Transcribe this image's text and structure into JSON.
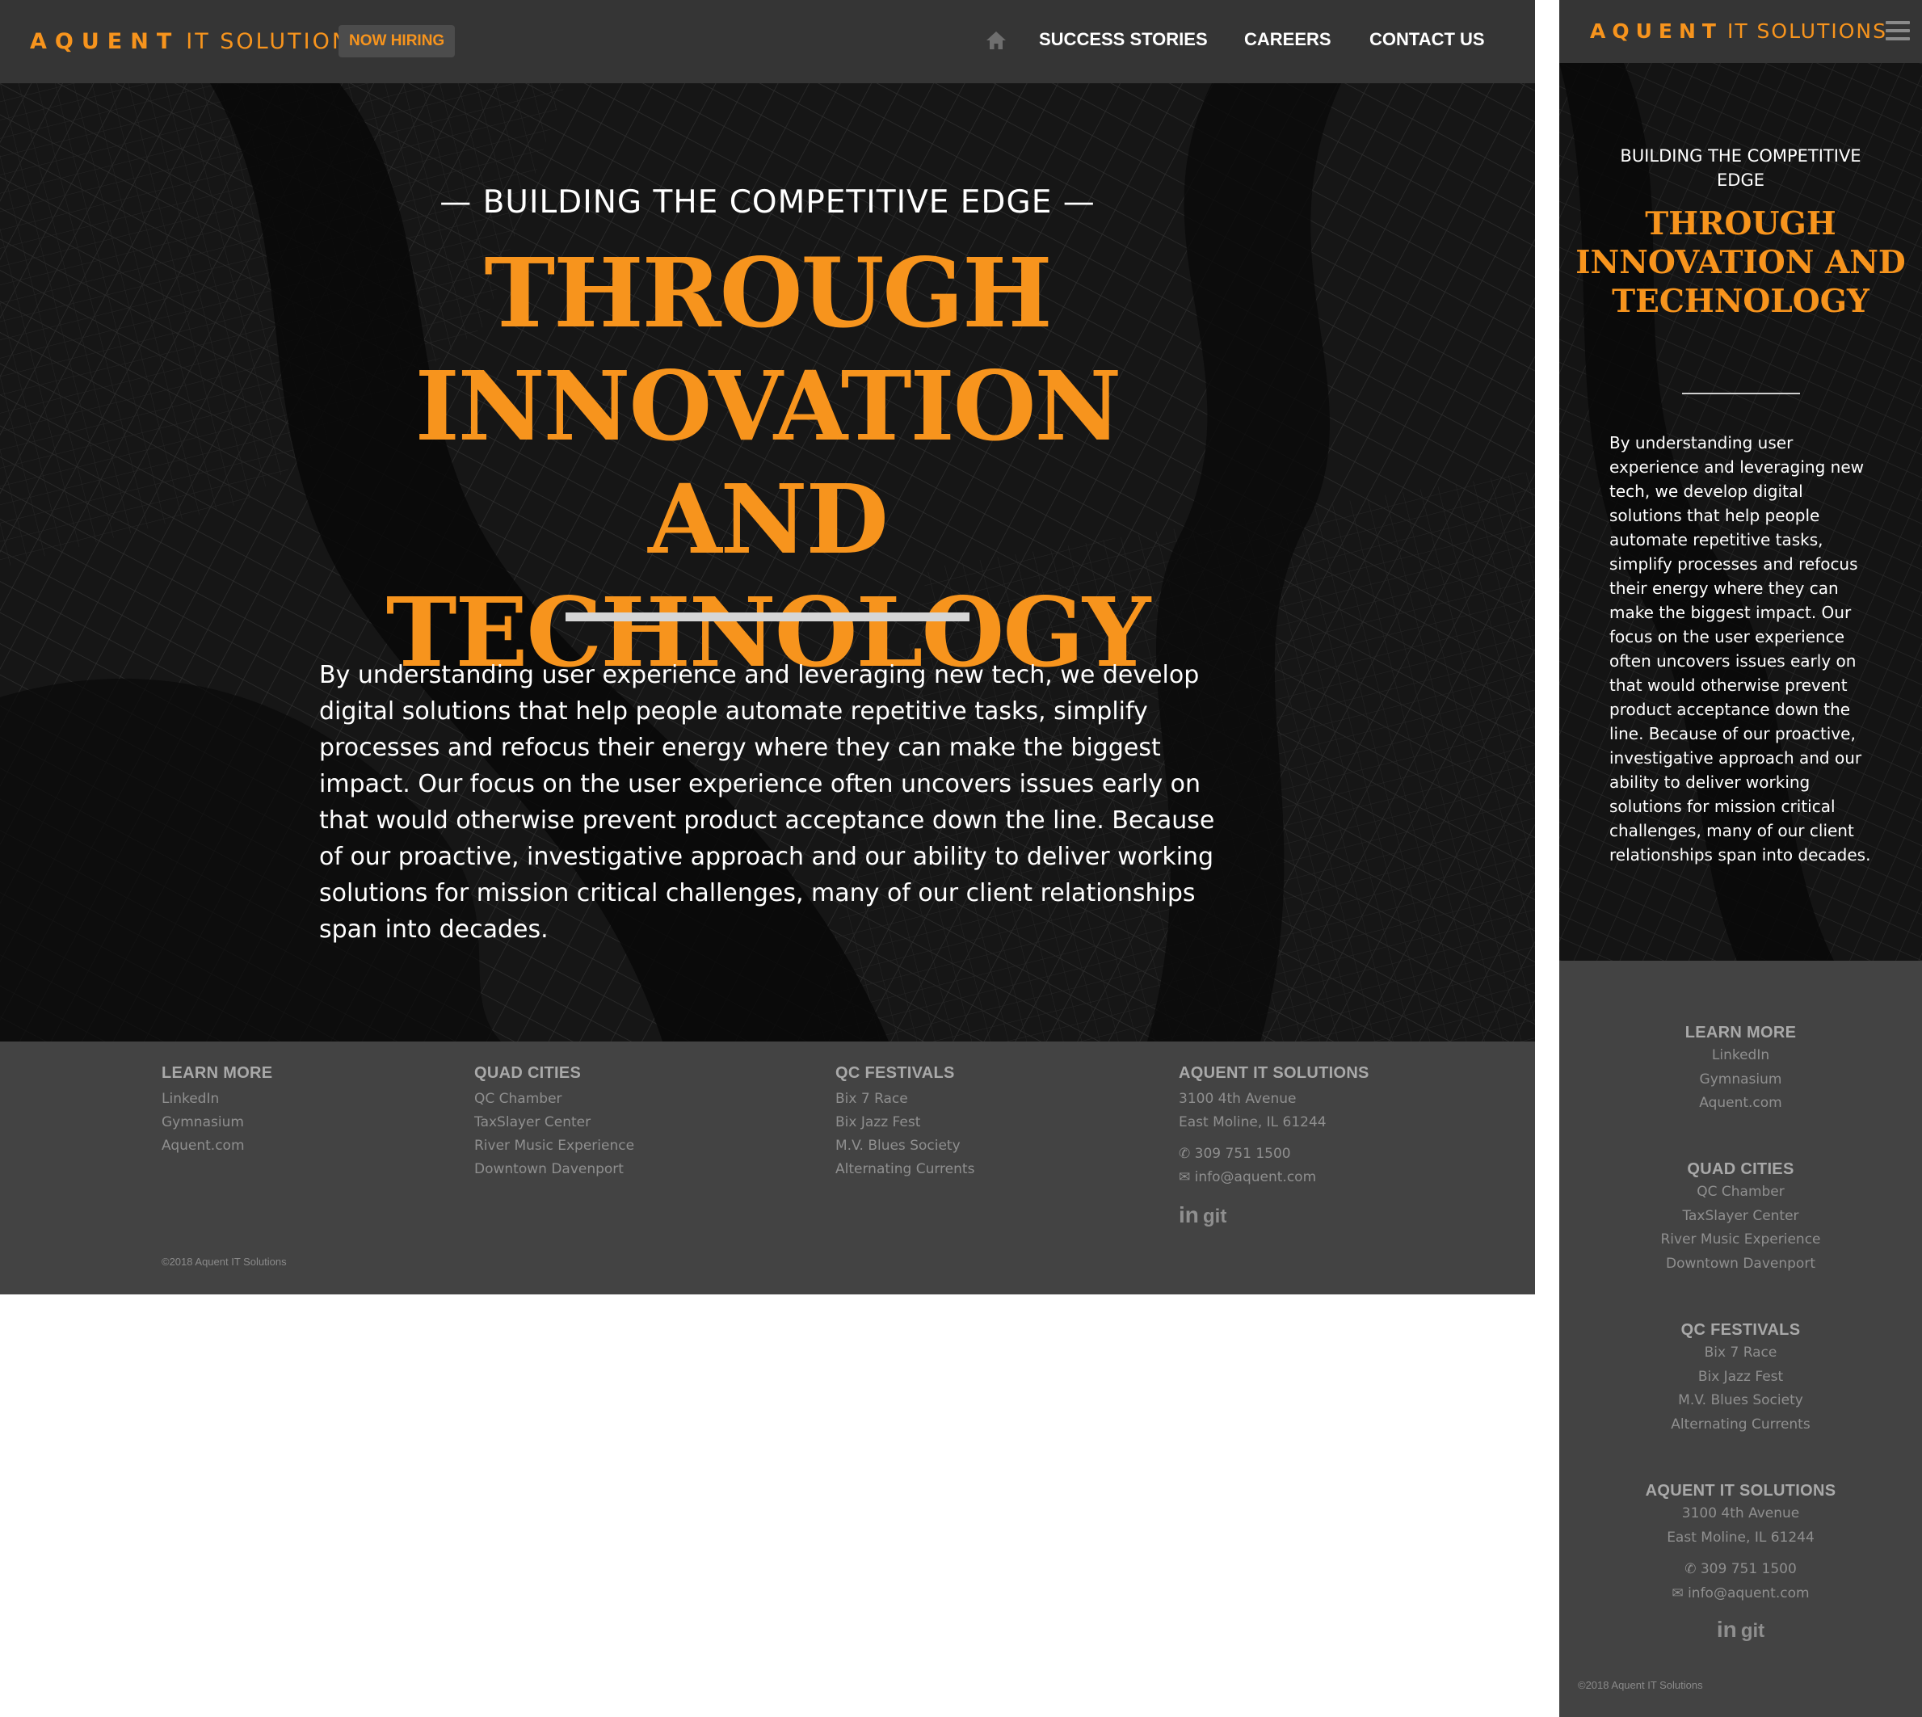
{
  "brand": {
    "name": "AQUENT",
    "suffix": "IT SOLUTIONS",
    "accent": "#f7941d"
  },
  "header": {
    "hiring_badge": "NOW HIRING",
    "home_icon": "home-icon",
    "nav": [
      "SUCCESS STORIES",
      "CAREERS",
      "CONTACT US"
    ],
    "menu_icon": "hamburger-menu-icon"
  },
  "hero": {
    "eyebrow_desktop": "— BUILDING THE COMPETITIVE EDGE —",
    "eyebrow_mobile": "BUILDING THE COMPETITIVE EDGE",
    "title": "THROUGH INNOVATION AND TECHNOLOGY",
    "body": "By understanding user experience and leveraging new tech, we develop digital solutions that help people automate repetitive tasks, simplify processes and refocus their energy where they can make the biggest impact. Our focus on the user experience often uncovers issues early on that would otherwise prevent product acceptance down the line. Because of our proactive, investigative approach and our ability to deliver working solutions for mission critical challenges, many of our client relationships span into decades."
  },
  "footer": {
    "learn_more": {
      "heading": "LEARN MORE",
      "links": [
        "LinkedIn",
        "Gymnasium",
        "Aquent.com"
      ]
    },
    "quad_cities": {
      "heading": "QUAD CITIES",
      "links": [
        "QC Chamber",
        "TaxSlayer Center",
        "River Music Experience",
        "Downtown Davenport"
      ]
    },
    "qc_festivals": {
      "heading": "QC FESTIVALS",
      "links": [
        "Bix 7 Race",
        "Bix Jazz Fest",
        "M.V. Blues Society",
        "Alternating Currents"
      ]
    },
    "company": {
      "heading": "AQUENT IT SOLUTIONS",
      "address_1": "3100 4th Avenue",
      "address_2": "East Moline, IL 61244",
      "phone": "309 751 1500",
      "email": "info@aquent.com"
    },
    "social": {
      "linkedin": "in",
      "github": "git"
    },
    "copyright": "©2018 Aquent IT Solutions"
  }
}
